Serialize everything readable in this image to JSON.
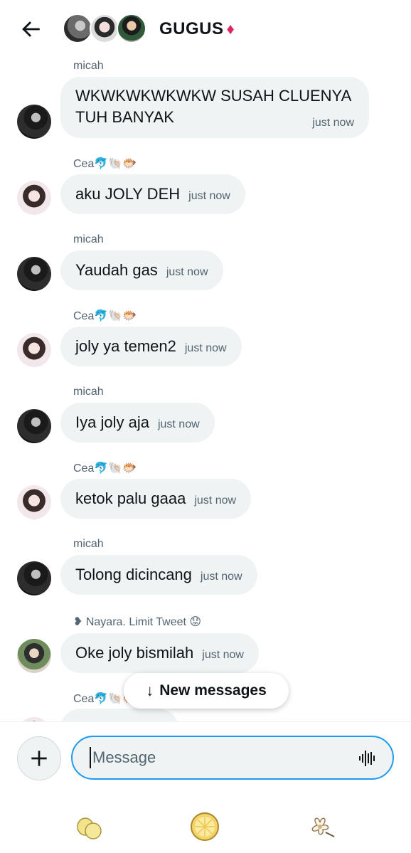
{
  "header": {
    "title": "GUGUS",
    "title_emoji": "♦"
  },
  "messages": [
    {
      "sender": "micah",
      "avatar": "avatar-micah",
      "line1": "WKWKWKWKWKW SUSAH CLUENYA",
      "line2": "TUH BANYAK",
      "time": "just now"
    },
    {
      "sender": "Cea🐬🐚🐡",
      "avatar": "avatar-cea",
      "text": "aku JOLY DEH",
      "time": "just now"
    },
    {
      "sender": "micah",
      "avatar": "avatar-micah",
      "text": "Yaudah gas",
      "time": "just now"
    },
    {
      "sender": "Cea🐬🐚🐡",
      "avatar": "avatar-cea",
      "text": "joly ya temen2",
      "time": "just now"
    },
    {
      "sender": "micah",
      "avatar": "avatar-micah",
      "text": "Iya joly aja",
      "time": "just now"
    },
    {
      "sender": "Cea🐬🐚🐡",
      "avatar": "avatar-cea",
      "text": "ketok palu gaaa",
      "time": "just now"
    },
    {
      "sender": "micah",
      "avatar": "avatar-micah",
      "text": "Tolong dicincang",
      "time": "just now"
    },
    {
      "sender": "❥ Nayara. Limit Tweet 😟",
      "avatar": "avatar-nayara",
      "text": "Oke joly bismilah",
      "time": "just now"
    },
    {
      "sender": "Cea🐬🐚🐡",
      "avatar": "avatar-cea"
    }
  ],
  "new_messages_label": "New messages",
  "composer": {
    "placeholder": "Message"
  },
  "colors": {
    "accent": "#1d9bf0",
    "bubble": "#eff3f4",
    "secondary_text": "#536471"
  },
  "icons": [
    "back-arrow-icon",
    "plus-icon",
    "voice-icon",
    "lemons-icon",
    "lemon-slice-icon",
    "flower-icon"
  ]
}
